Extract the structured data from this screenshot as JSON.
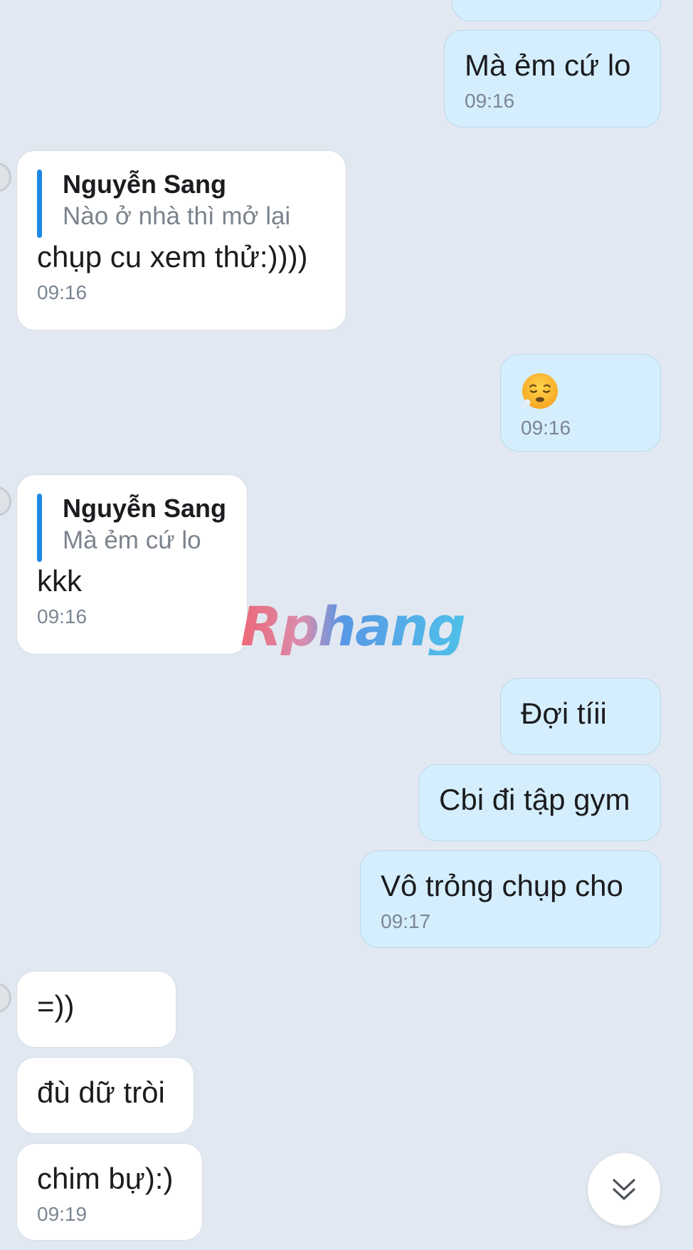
{
  "messages": {
    "m0": {
      "direction": "outgoing"
    },
    "m1": {
      "direction": "outgoing",
      "text": "Mà ẻm cứ lo",
      "time": "09:16"
    },
    "m2": {
      "direction": "incoming",
      "quote_name": "Nguyễn Sang",
      "quote_text": "Nào ở nhà thì mở lại",
      "text": "chụp cu xem thử:))))",
      "time": "09:16"
    },
    "m3": {
      "direction": "outgoing",
      "emoji": "tired-face-emoji",
      "time": "09:16"
    },
    "m4": {
      "direction": "incoming",
      "quote_name": "Nguyễn Sang",
      "quote_text": "Mà ẻm cứ lo",
      "text": "kkk",
      "time": "09:16"
    },
    "m5": {
      "direction": "outgoing",
      "text": "Đợi tíii"
    },
    "m6": {
      "direction": "outgoing",
      "text": "Cbi đi tập gym"
    },
    "m7": {
      "direction": "outgoing",
      "text": "Vô trỏng chụp cho",
      "time": "09:17"
    },
    "m8": {
      "direction": "incoming",
      "text": "=))"
    },
    "m9": {
      "direction": "incoming",
      "text": "đù dữ tròi"
    },
    "m10": {
      "direction": "incoming",
      "text": "chim bự):)",
      "time": "09:19"
    }
  },
  "watermark": {
    "text": "Rphang"
  },
  "scroll_button": {
    "icon": "double-chevron-down-icon"
  },
  "colors": {
    "background": "#e2e8f1",
    "outgoing_bubble": "#d5eefd",
    "incoming_bubble": "#ffffff",
    "quote_bar": "#1e88e5",
    "timestamp": "#7c8692"
  }
}
